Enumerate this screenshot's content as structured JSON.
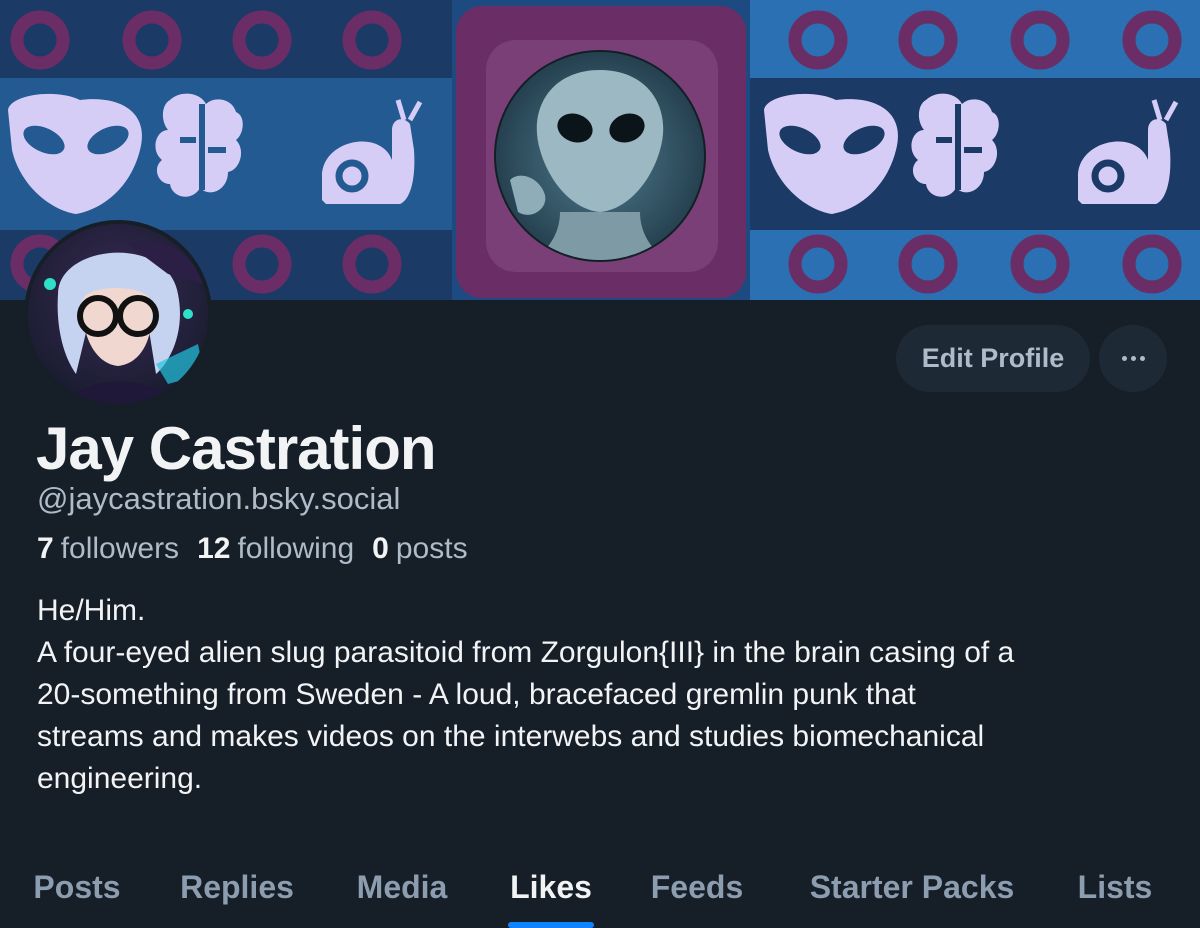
{
  "profile": {
    "display_name": "Jay Castration",
    "handle": "@jaycastration.bsky.social",
    "followers_count": "7",
    "followers_label": "followers",
    "following_count": "12",
    "following_label": "following",
    "posts_count": "0",
    "posts_label": "posts",
    "bio_lines": [
      "He/Him.",
      "A four-eyed alien slug parasitoid from Zorgulon{III} in the brain casing of a",
      "20-something from Sweden - A loud, bracefaced gremlin punk that",
      "streams and makes videos on the interwebs and studies biomechanical",
      "engineering."
    ]
  },
  "actions": {
    "edit_profile_label": "Edit Profile",
    "more_icon": "ellipsis-icon"
  },
  "tabs": [
    {
      "label": "Posts",
      "active": false
    },
    {
      "label": "Replies",
      "active": false
    },
    {
      "label": "Media",
      "active": false
    },
    {
      "label": "Likes",
      "active": true
    },
    {
      "label": "Feeds",
      "active": false
    },
    {
      "label": "Starter Packs",
      "active": false
    },
    {
      "label": "Lists",
      "active": false
    }
  ],
  "colors": {
    "background": "#161e27",
    "accent": "#1083fe",
    "banner_dark_blue": "#1a3a66",
    "banner_light_blue": "#2b6fb0",
    "banner_purple": "#6b2d66",
    "banner_lavender": "#d6cdf7"
  }
}
